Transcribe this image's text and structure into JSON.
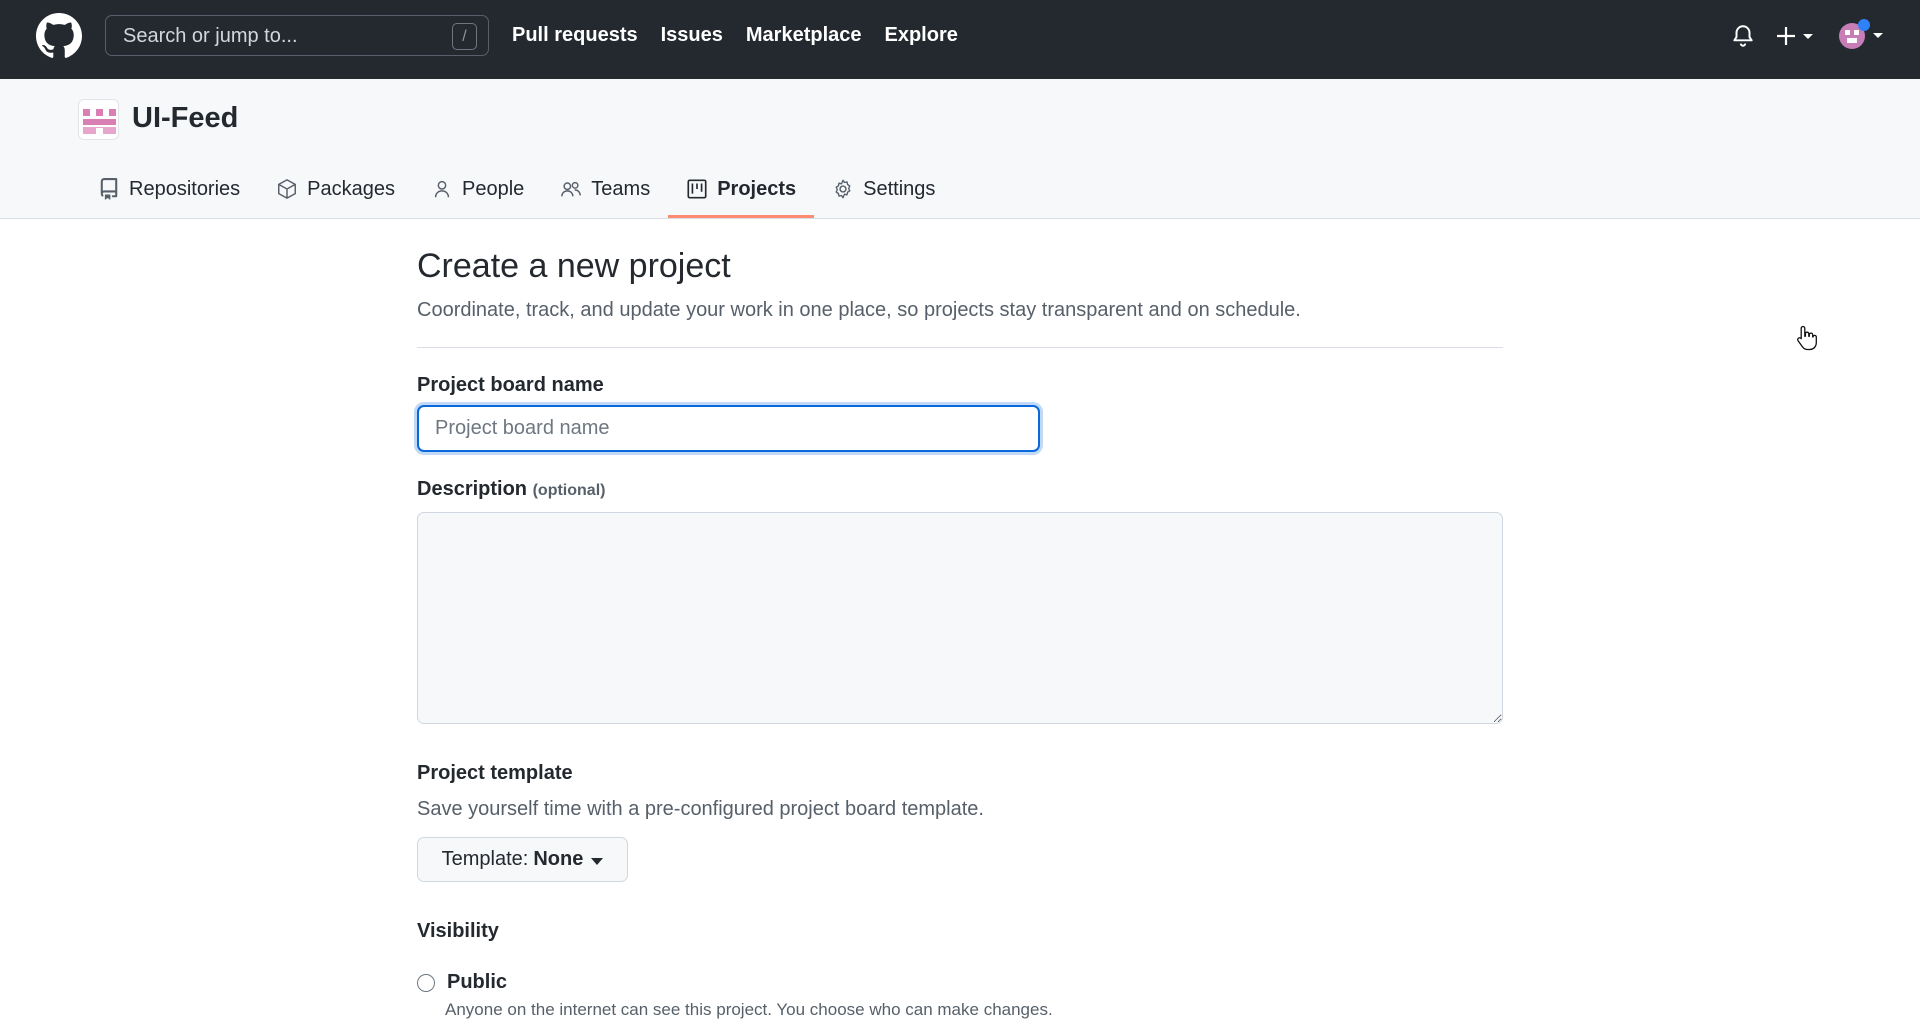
{
  "header": {
    "search_placeholder": "Search or jump to...",
    "search_key": "/",
    "nav": [
      "Pull requests",
      "Issues",
      "Marketplace",
      "Explore"
    ]
  },
  "org": {
    "name": "UI-Feed",
    "tabs": [
      {
        "label": "Repositories",
        "icon": "repo-icon"
      },
      {
        "label": "Packages",
        "icon": "package-icon"
      },
      {
        "label": "People",
        "icon": "person-icon"
      },
      {
        "label": "Teams",
        "icon": "people-icon"
      },
      {
        "label": "Projects",
        "icon": "project-icon",
        "active": true
      },
      {
        "label": "Settings",
        "icon": "gear-icon"
      }
    ]
  },
  "form": {
    "title": "Create a new project",
    "subtitle": "Coordinate, track, and update your work in one place, so projects stay transparent and on schedule.",
    "name_label": "Project board name",
    "name_placeholder": "Project board name",
    "name_value": "",
    "description_label": "Description",
    "description_optional": "(optional)",
    "template_label": "Project template",
    "template_sub": "Save yourself time with a pre-configured project board template.",
    "template_prefix": "Template:",
    "template_value": "None",
    "visibility_label": "Visibility",
    "public_label": "Public",
    "public_desc": "Anyone on the internet can see this project. You choose who can make changes."
  },
  "colors": {
    "header_bg": "#24292f",
    "accent": "#0969da",
    "active_tab_underline": "#fd8c73",
    "org_avatar_pink": "#d97fb3"
  }
}
